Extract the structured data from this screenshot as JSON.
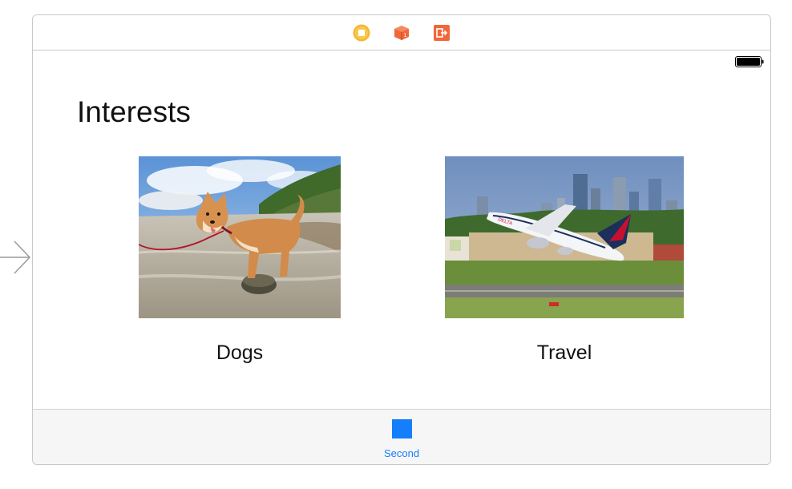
{
  "scene": {
    "dock_icons": [
      "view-controller-icon",
      "first-responder-icon",
      "exit-icon"
    ],
    "status_bar": {
      "battery_icon": "battery-icon"
    },
    "title": "Interests",
    "interests": [
      {
        "label": "Dogs",
        "image": "shiba-inu-dog-photo"
      },
      {
        "label": "Travel",
        "image": "airplane-takeoff-photo"
      }
    ],
    "tab_bar": {
      "items": [
        {
          "label": "Second",
          "icon": "square-icon",
          "selected": true
        }
      ]
    }
  },
  "colors": {
    "tint": "#157efb",
    "dock_yellow": "#f5b731",
    "dock_orange": "#f0683a",
    "delta_red": "#c8102e"
  }
}
